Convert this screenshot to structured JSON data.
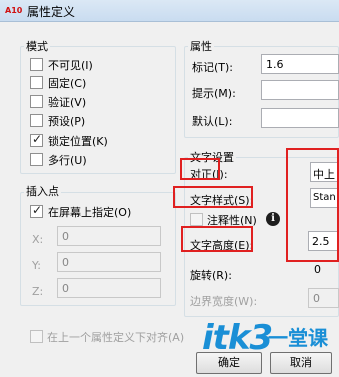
{
  "window": {
    "title": "属性定义",
    "app_icon_text": "A10"
  },
  "mode": {
    "group_label": "模式",
    "options": [
      {
        "label": "不可见(I)",
        "checked": false
      },
      {
        "label": "固定(C)",
        "checked": false
      },
      {
        "label": "验证(V)",
        "checked": false
      },
      {
        "label": "预设(P)",
        "checked": false
      },
      {
        "label": "锁定位置(K)",
        "checked": true
      },
      {
        "label": "多行(U)",
        "checked": false
      }
    ]
  },
  "attribute": {
    "group_label": "属性",
    "tag_label": "标记(T):",
    "tag_value": "1.6",
    "prompt_label": "提示(M):",
    "prompt_value": "",
    "default_label": "默认(L):",
    "default_value": ""
  },
  "insertion": {
    "group_label": "插入点",
    "on_screen_label": "在屏幕上指定(O)",
    "on_screen_checked": true,
    "x_label": "X:",
    "x_value": "0",
    "y_label": "Y:",
    "y_value": "0",
    "z_label": "Z:",
    "z_value": "0"
  },
  "text_settings": {
    "group_label": "文字设置",
    "justify_label": "对正(J):",
    "justify_value": "中上",
    "style_label": "文字样式(S):",
    "style_value": "Stan",
    "annotative_label": "注释性(N)",
    "height_label": "文字高度(E):",
    "height_value": "2.5",
    "rotation_label": "旋转(R):",
    "rotation_value": "0",
    "boundary_label": "边界宽度(W):",
    "boundary_value": "0"
  },
  "align_below_label": "在上一个属性定义下对齐(A)",
  "buttons": {
    "ok": "确定",
    "cancel": "取消"
  },
  "watermark": {
    "brand": "itk3",
    "cn": "一堂课"
  },
  "colors": {
    "highlight": "#e02020",
    "watermark": "#1a8fd6"
  }
}
